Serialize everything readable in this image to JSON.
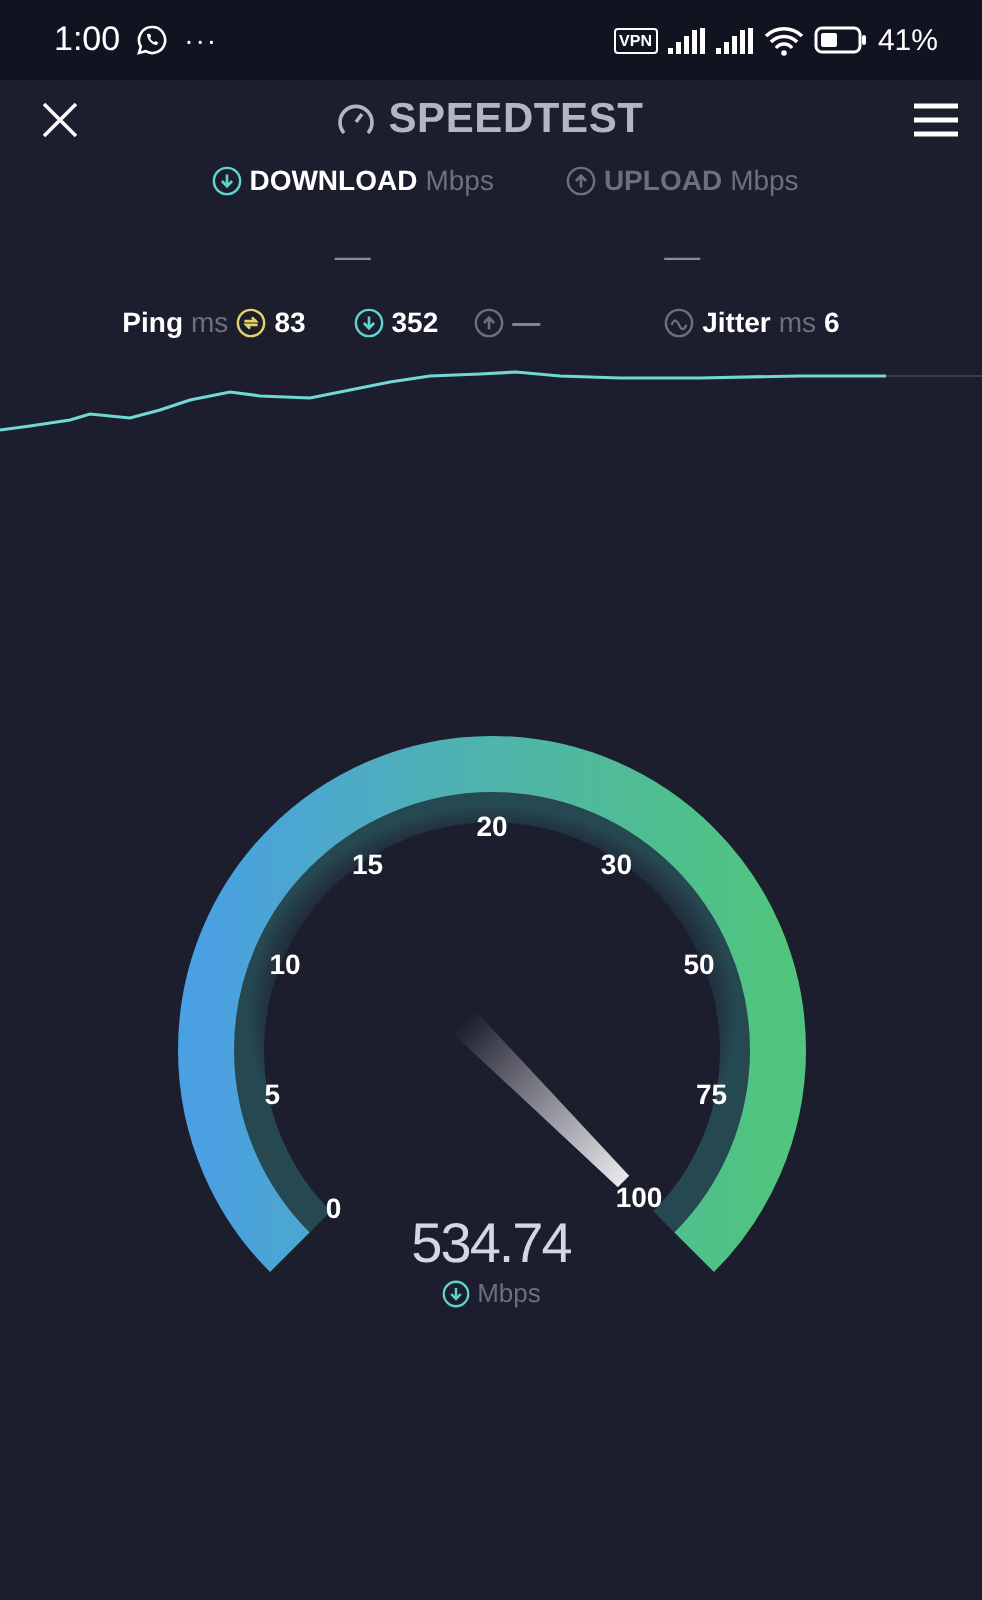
{
  "status_bar": {
    "time": "1:00",
    "overflow": "···",
    "vpn": "VPN",
    "battery": "41%"
  },
  "header": {
    "title": "SPEEDTEST"
  },
  "tabs": [
    {
      "kind": "download",
      "label": "DOWNLOAD",
      "unit": "Mbps",
      "selected": true,
      "value": "—"
    },
    {
      "kind": "upload",
      "label": "UPLOAD",
      "unit": "Mbps",
      "selected": false,
      "value": "—"
    }
  ],
  "stats": [
    {
      "kind": "ping",
      "label": "Ping",
      "unit": "ms",
      "value": "83"
    },
    {
      "kind": "download",
      "value": "352"
    },
    {
      "kind": "upload",
      "value": "—"
    },
    {
      "kind": "jitter",
      "label": "Jitter",
      "unit": "ms",
      "value": "6"
    }
  ],
  "gauge": {
    "ticks": [
      "0",
      "5",
      "10",
      "15",
      "20",
      "30",
      "50",
      "75",
      "100"
    ],
    "reading": "534.74",
    "unit": "Mbps"
  }
}
